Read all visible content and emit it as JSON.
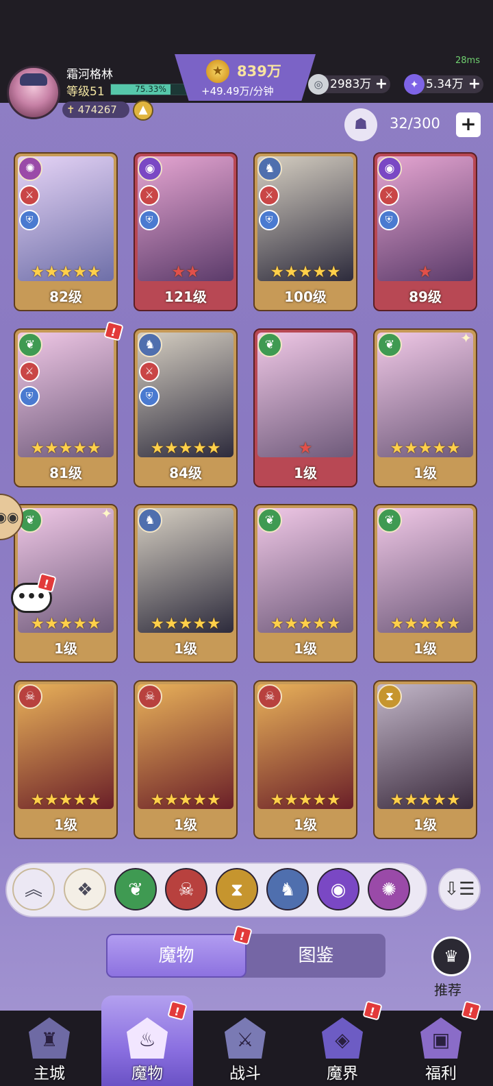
{
  "status": {
    "ping": "28ms"
  },
  "player": {
    "name": "霜河格林",
    "level_label": "等级51",
    "xp_percent_label": "75.33%",
    "xp_fraction": 0.7533,
    "power": "474267",
    "upgrade_icon": "arrow-up-icon"
  },
  "resources": {
    "gold": "839万",
    "gold_rate": "+49.49万/分钟",
    "silver": "2983万",
    "crystal": "5.34万"
  },
  "capacity": {
    "value": "32/300",
    "plus_label": "+"
  },
  "monsters": [
    {
      "level": "82级",
      "stars": 5,
      "faction": "vortex",
      "frame": "gold",
      "badges": [
        "attack",
        "defense"
      ]
    },
    {
      "level": "121级",
      "stars": 2,
      "faction": "eye",
      "frame": "red",
      "badges": [
        "attack",
        "defense"
      ]
    },
    {
      "level": "100级",
      "stars": 5,
      "faction": "dragon",
      "frame": "gold",
      "badges": [
        "attack",
        "defense"
      ]
    },
    {
      "level": "89级",
      "stars": 1,
      "faction": "eye",
      "frame": "red",
      "badges": [
        "attack",
        "defense"
      ]
    },
    {
      "level": "81级",
      "stars": 5,
      "faction": "leaf",
      "frame": "gold",
      "badges": [
        "attack",
        "defense"
      ],
      "alert": true
    },
    {
      "level": "84级",
      "stars": 5,
      "faction": "dragon",
      "frame": "gold",
      "badges": [
        "attack",
        "defense"
      ]
    },
    {
      "level": "1级",
      "stars": 1,
      "faction": "leaf",
      "frame": "red",
      "badges": []
    },
    {
      "level": "1级",
      "stars": 5,
      "faction": "leaf",
      "frame": "gold",
      "badges": [],
      "spark": true
    },
    {
      "level": "1级",
      "stars": 5,
      "faction": "leaf",
      "frame": "gold",
      "badges": [],
      "spark": true
    },
    {
      "level": "1级",
      "stars": 5,
      "faction": "dragon",
      "frame": "gold",
      "badges": []
    },
    {
      "level": "1级",
      "stars": 5,
      "faction": "leaf",
      "frame": "gold",
      "badges": []
    },
    {
      "level": "1级",
      "stars": 5,
      "faction": "leaf",
      "frame": "gold",
      "badges": []
    },
    {
      "level": "1级",
      "stars": 5,
      "faction": "demon",
      "frame": "gold",
      "badges": []
    },
    {
      "level": "1级",
      "stars": 5,
      "faction": "demon",
      "frame": "gold",
      "badges": []
    },
    {
      "level": "1级",
      "stars": 5,
      "faction": "demon",
      "frame": "gold",
      "badges": []
    },
    {
      "level": "1级",
      "stars": 5,
      "faction": "hourglass",
      "frame": "gold",
      "badges": []
    }
  ],
  "filters": [
    {
      "icon": "collapse-up-icon",
      "color": "#ece8f4"
    },
    {
      "icon": "all-diamond-icon",
      "color": "#f4efe6"
    },
    {
      "icon": "leaf-faction-icon",
      "color": "#3f9a52"
    },
    {
      "icon": "demon-faction-icon",
      "color": "#b8413e"
    },
    {
      "icon": "hourglass-faction-icon",
      "color": "#c6952e"
    },
    {
      "icon": "dragon-faction-icon",
      "color": "#4f6fae"
    },
    {
      "icon": "eye-faction-icon",
      "color": "#7a48c4"
    },
    {
      "icon": "vortex-faction-icon",
      "color": "#9a4aa8"
    }
  ],
  "tabs": {
    "active": "魔物",
    "inactive": "图鉴"
  },
  "recommend_label": "推荐",
  "nav": [
    {
      "label": "主城",
      "icon": "castle-icon"
    },
    {
      "label": "魔物",
      "icon": "flame-icon",
      "active": true
    },
    {
      "label": "战斗",
      "icon": "shield-sword-icon"
    },
    {
      "label": "魔界",
      "icon": "portal-icon"
    },
    {
      "label": "福利",
      "icon": "chest-icon"
    }
  ]
}
